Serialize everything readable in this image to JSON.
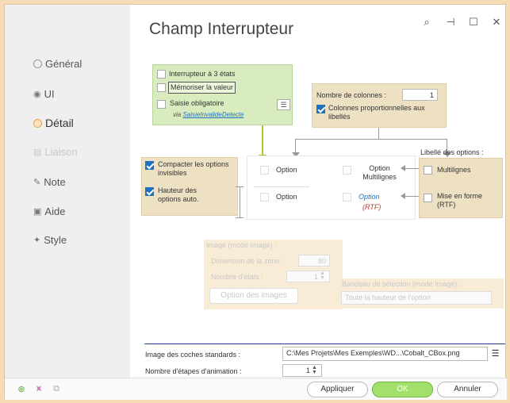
{
  "window": {
    "title": "Champ Interrupteur"
  },
  "sidebar": {
    "items": [
      {
        "label": "Général"
      },
      {
        "label": "UI"
      },
      {
        "label": "Détail"
      },
      {
        "label": "Liaison"
      },
      {
        "label": "Note"
      },
      {
        "label": "Aide"
      },
      {
        "label": "Style"
      }
    ]
  },
  "green_panel": {
    "interrupteur_3": "Interrupteur à 3 états",
    "memoriser": "Mémoriser la valeur",
    "saisie": "Saisie obligatoire",
    "via": "via",
    "link": "SaisieInvalideDetecte"
  },
  "columns_panel": {
    "nb_label": "Nombre de colonnes :",
    "nb_value": "1",
    "proportional": "Colonnes proportionnelles aux libellés"
  },
  "left_panel": {
    "compacter": "Compacter les options invisibles",
    "hauteur": "Hauteur des options auto."
  },
  "preview": {
    "option1": "Option",
    "option2": "Option",
    "multi": "Option Multilignes",
    "rtf_option": "Option",
    "rtf_tag": "(RTF)"
  },
  "libelle_panel": {
    "title": "Libellé des options :",
    "multilignes": "Multilignes",
    "mise_en_forme": "Mise en forme (RTF)"
  },
  "image_panel": {
    "title": "Image (mode Image) :",
    "dimension_label": "Dimension de la zone :",
    "dimension_value": "80",
    "etats_label": "Nombre d'états :",
    "etats_value": "1",
    "images_button": "Option des images",
    "bandeau_title": "Bandeau de sélection (mode Image) :",
    "bandeau_value": "Toute la hauteur de l'option"
  },
  "footer_fields": {
    "coches_label": "Image des coches standards :",
    "coches_value": "C:\\Mes Projets\\Mes Exemples\\WD...\\Cobalt_CBox.png",
    "etapes_label": "Nombre d'étapes d'animation :",
    "etapes_value": "1"
  },
  "buttons": {
    "apply": "Appliquer",
    "ok": "OK",
    "cancel": "Annuler"
  },
  "colors": {
    "accent_orange": "#e8a64b",
    "green_panel": "#d8ecbf",
    "tan_panel": "#eee0c3",
    "checkbox_blue": "#1e70c1",
    "ok_green": "#a3e06b"
  }
}
